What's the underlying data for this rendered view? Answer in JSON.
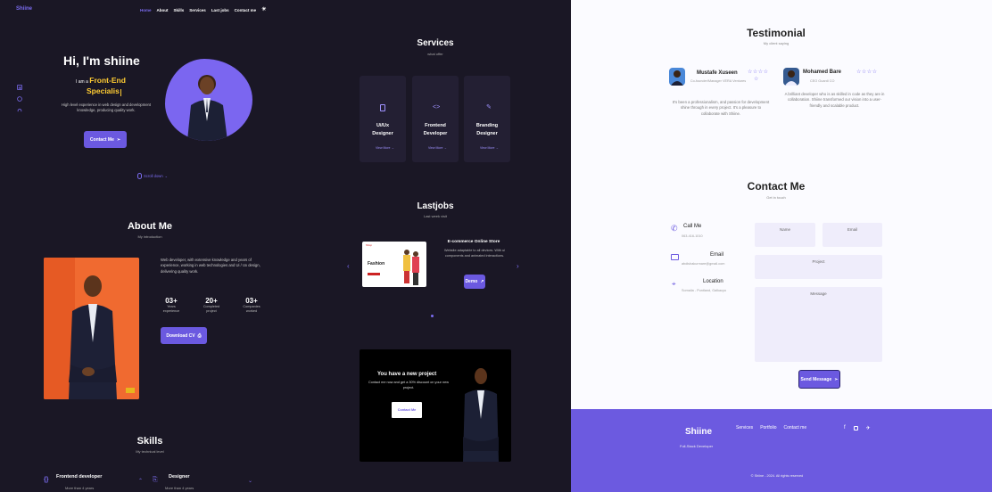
{
  "nav": {
    "logo": "Shiine",
    "links": [
      "Home",
      "About",
      "Skills",
      "Services",
      "Last jobs",
      "Contact me"
    ],
    "active_index": 0
  },
  "hero": {
    "greeting": "Hi, I'm shiine",
    "role_prefix": "I am a",
    "role_line1": "Front-End",
    "role_line2": "Specialis",
    "description": "High level experience in web design and development knowledge, producing quality work.",
    "contact_button": "Contact Me",
    "scroll_down": "Scroll down"
  },
  "about": {
    "title": "About Me",
    "subtitle": "My introduction",
    "description": "Web developer, with extensive knowledge and years of experience, working in web technologies and Ui / Ux design, delivering quality work.",
    "stats": [
      {
        "value": "03+",
        "label1": "Years",
        "label2": "experience"
      },
      {
        "value": "20+",
        "label1": "Completed",
        "label2": "project"
      },
      {
        "value": "03+",
        "label1": "Companies",
        "label2": "worked"
      }
    ],
    "cv_button": "Download CV"
  },
  "skills": {
    "title": "Skills",
    "subtitle": "My technical level",
    "items": [
      {
        "title": "Frontend developer",
        "sub": "More than 4 years"
      },
      {
        "title": "Designer",
        "sub": "More than 4 years"
      }
    ]
  },
  "services": {
    "title": "Services",
    "subtitle": "what offer",
    "cards": [
      {
        "line1": "Ui/Ux",
        "line2": "Designer",
        "link": "View More"
      },
      {
        "line1": "Frontend",
        "line2": "Developer",
        "link": "View More"
      },
      {
        "line1": "Branding",
        "line2": "Designer",
        "link": "View More"
      }
    ]
  },
  "lastjobs": {
    "title": "Lastjobs",
    "subtitle": "Last week visit",
    "project_title": "E-commerce Online Store",
    "project_desc": "Website adaptable to all devices. With ui components and animated interactions.",
    "demo_button": "Demo",
    "thumb_logo": "Shop",
    "thumb_text": "Fashion"
  },
  "promo": {
    "title": "You have a new project",
    "text": "Contact me now and get a 30% discount on your new project.",
    "button": "Contact Me"
  },
  "testimonial": {
    "title": "Testimonial",
    "subtitle": "My client saying",
    "items": [
      {
        "name": "Mustafe Xuseen",
        "role": "Co-founder/Manager VERA Ventures",
        "text": "It's been a professionalism, and passion for development shine through in every project. It's a pleasure to collaborate with Shiine."
      },
      {
        "name": "Mohamed Bare",
        "role": "CEO Guardi CO",
        "text": "A brilliant developer who is as skilled in code as they are in collaboration. Shiine transformed our vision into a user-friendly and scalable product."
      }
    ],
    "stars": "☆☆☆☆"
  },
  "contact": {
    "title": "Contact Me",
    "subtitle": "Get in touch",
    "methods": [
      {
        "label": "Call Me",
        "value": "063-416-1010"
      },
      {
        "label": "Email",
        "value": "abdishakurmare@gmail.com"
      },
      {
        "label": "Location",
        "value": "Somalia - Puntland, Galkacyo"
      }
    ],
    "fields": {
      "name": "Name",
      "email": "Email",
      "project": "Project",
      "message": "Message"
    },
    "send_button": "Send Message"
  },
  "footer": {
    "logo": "Shiine",
    "tagline": "Full-Stack Developer",
    "links": [
      "Services",
      "Portfolio",
      "Contact me"
    ],
    "copyright": "© Shiine - 2024. All rights reserved"
  },
  "colors": {
    "accent": "#6b59e0",
    "dark_bg": "#1a1725",
    "highlight": "#ffcc33",
    "footer_bg": "#6c5ae0"
  }
}
